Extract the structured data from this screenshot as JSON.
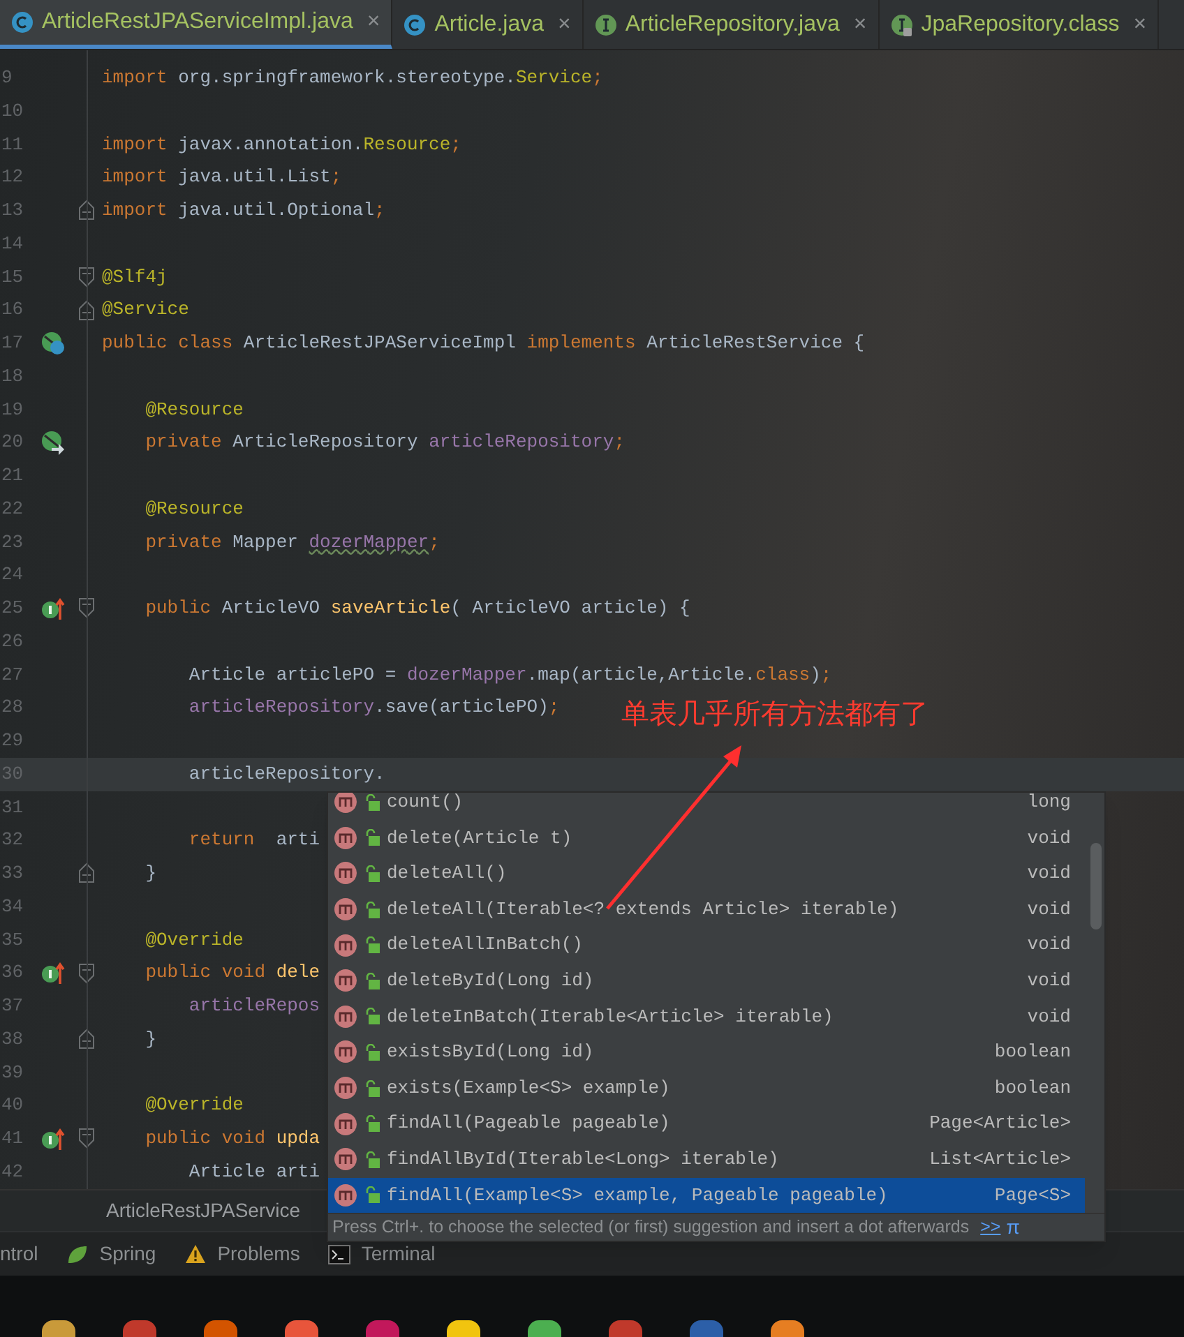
{
  "tabs": [
    {
      "label": "ArticleRestJPAServiceImpl.java",
      "kind": "class",
      "locked": false,
      "selected": true,
      "close": "×"
    },
    {
      "label": "Article.java",
      "kind": "class",
      "locked": false,
      "selected": false,
      "close": "×"
    },
    {
      "label": "ArticleRepository.java",
      "kind": "interface",
      "locked": false,
      "selected": false,
      "close": "×"
    },
    {
      "label": "JpaRepository.class",
      "kind": "interface",
      "locked": true,
      "selected": false,
      "close": "×"
    }
  ],
  "editor": {
    "lines": [
      {
        "number": "9",
        "current": false,
        "tokens": [
          {
            "kind": "kw",
            "text": "import"
          },
          {
            "kind": "text",
            "text": " org.springframework.stereotype."
          },
          {
            "kind": "ann",
            "text": "Service"
          },
          {
            "kind": "semi",
            "text": ";"
          }
        ]
      },
      {
        "number": "10",
        "current": false
      },
      {
        "number": "11",
        "current": false,
        "tokens": [
          {
            "kind": "kw",
            "text": "import"
          },
          {
            "kind": "text",
            "text": " javax.annotation."
          },
          {
            "kind": "ann",
            "text": "Resource"
          },
          {
            "kind": "semi",
            "text": ";"
          }
        ]
      },
      {
        "number": "12",
        "current": false,
        "tokens": [
          {
            "kind": "kw",
            "text": "import"
          },
          {
            "kind": "text",
            "text": " java.util.List"
          },
          {
            "kind": "semi",
            "text": ";"
          }
        ]
      },
      {
        "number": "13",
        "current": false,
        "fold": {
          "kind": "end"
        },
        "tokens": [
          {
            "kind": "kw",
            "text": "import"
          },
          {
            "kind": "text",
            "text": " java.util.Optional"
          },
          {
            "kind": "semi",
            "text": ";"
          }
        ]
      },
      {
        "number": "14",
        "current": false
      },
      {
        "number": "15",
        "current": false,
        "fold": {
          "kind": "start"
        },
        "tokens": [
          {
            "kind": "ann",
            "text": "@Slf4j"
          }
        ]
      },
      {
        "number": "16",
        "current": false,
        "fold": {
          "kind": "end"
        },
        "tokens": [
          {
            "kind": "ann",
            "text": "@Service"
          }
        ]
      },
      {
        "number": "17",
        "current": false,
        "gutter": {
          "kind": "class"
        },
        "tokens": [
          {
            "kind": "kw",
            "text": "public class"
          },
          {
            "kind": "text",
            "text": " ArticleRestJPAServiceImpl "
          },
          {
            "kind": "kw",
            "text": "implements"
          },
          {
            "kind": "text",
            "text": " ArticleRestService {"
          }
        ]
      },
      {
        "number": "18",
        "current": false
      },
      {
        "number": "19",
        "current": false,
        "tokens": [
          {
            "kind": "ann",
            "text": "    @Resource"
          }
        ]
      },
      {
        "number": "20",
        "current": false,
        "gutter": {
          "kind": "field"
        },
        "tokens": [
          {
            "kind": "kw",
            "text": "    private"
          },
          {
            "kind": "text",
            "text": " ArticleRepository "
          },
          {
            "kind": "field",
            "text": "articleRepository"
          },
          {
            "kind": "semi",
            "text": ";"
          }
        ]
      },
      {
        "number": "21",
        "current": false
      },
      {
        "number": "22",
        "current": false,
        "tokens": [
          {
            "kind": "ann",
            "text": "    @Resource"
          }
        ]
      },
      {
        "number": "23",
        "current": false,
        "tokens": [
          {
            "kind": "kw",
            "text": "    private"
          },
          {
            "kind": "text",
            "text": " Mapper "
          },
          {
            "kind": "warn",
            "text": "dozerMapper"
          },
          {
            "kind": "semi",
            "text": ";"
          }
        ]
      },
      {
        "number": "24",
        "current": false
      },
      {
        "number": "25",
        "current": false,
        "gutter": {
          "kind": "implements"
        },
        "fold": {
          "kind": "start"
        },
        "tokens": [
          {
            "kind": "kw",
            "text": "    public"
          },
          {
            "kind": "text",
            "text": " ArticleVO "
          },
          {
            "kind": "fn",
            "text": "saveArticle"
          },
          {
            "kind": "text",
            "text": "( ArticleVO article) {"
          }
        ]
      },
      {
        "number": "26",
        "current": false
      },
      {
        "number": "27",
        "current": false,
        "tokens": [
          {
            "kind": "text",
            "text": "        Article articlePO = "
          },
          {
            "kind": "field",
            "text": "dozerMapper"
          },
          {
            "kind": "text",
            "text": ".map(article,Article."
          },
          {
            "kind": "kw",
            "text": "class"
          },
          {
            "kind": "text",
            "text": ")"
          },
          {
            "kind": "semi",
            "text": ";"
          }
        ]
      },
      {
        "number": "28",
        "current": false,
        "tokens": [
          {
            "kind": "field",
            "text": "        articleRepository"
          },
          {
            "kind": "text",
            "text": ".save(articlePO)"
          },
          {
            "kind": "semi",
            "text": ";"
          }
        ]
      },
      {
        "number": "29",
        "current": false
      },
      {
        "number": "30",
        "current": true,
        "tokens": [
          {
            "kind": "text",
            "text": "        articleRepository."
          }
        ]
      },
      {
        "number": "31",
        "current": false
      },
      {
        "number": "32",
        "current": false,
        "tokens": [
          {
            "kind": "kw",
            "text": "        return"
          },
          {
            "kind": "text",
            "text": "  arti"
          }
        ]
      },
      {
        "number": "33",
        "current": false,
        "fold": {
          "kind": "end"
        },
        "tokens": [
          {
            "kind": "text",
            "text": "    }"
          }
        ]
      },
      {
        "number": "34",
        "current": false
      },
      {
        "number": "35",
        "current": false,
        "tokens": [
          {
            "kind": "ann",
            "text": "    @Override"
          }
        ]
      },
      {
        "number": "36",
        "current": false,
        "gutter": {
          "kind": "implements"
        },
        "fold": {
          "kind": "start"
        },
        "tokens": [
          {
            "kind": "kw",
            "text": "    public void "
          },
          {
            "kind": "fn",
            "text": "dele"
          }
        ]
      },
      {
        "number": "37",
        "current": false,
        "tokens": [
          {
            "kind": "field",
            "text": "        articleRepos"
          }
        ]
      },
      {
        "number": "38",
        "current": false,
        "fold": {
          "kind": "end"
        },
        "tokens": [
          {
            "kind": "text",
            "text": "    }"
          }
        ]
      },
      {
        "number": "39",
        "current": false
      },
      {
        "number": "40",
        "current": false,
        "tokens": [
          {
            "kind": "ann",
            "text": "    @Override"
          }
        ]
      },
      {
        "number": "41",
        "current": false,
        "gutter": {
          "kind": "implements"
        },
        "fold": {
          "kind": "start"
        },
        "tokens": [
          {
            "kind": "kw",
            "text": "    public void "
          },
          {
            "kind": "fn",
            "text": "upda"
          }
        ]
      },
      {
        "number": "42",
        "current": false,
        "tokens": [
          {
            "kind": "text",
            "text": "        Article arti"
          }
        ]
      }
    ]
  },
  "completion": {
    "items": [
      {
        "name": "count()",
        "type": "long",
        "selected": false
      },
      {
        "name": "delete(Article t)",
        "type": "void",
        "selected": false
      },
      {
        "name": "deleteAll()",
        "type": "void",
        "selected": false
      },
      {
        "name": "deleteAll(Iterable<? extends Article> iterable)",
        "type": "void",
        "selected": false
      },
      {
        "name": "deleteAllInBatch()",
        "type": "void",
        "selected": false
      },
      {
        "name": "deleteById(Long id)",
        "type": "void",
        "selected": false
      },
      {
        "name": "deleteInBatch(Iterable<Article> iterable)",
        "type": "void",
        "selected": false
      },
      {
        "name": "existsById(Long id)",
        "type": "boolean",
        "selected": false
      },
      {
        "name": "exists(Example<S> example)",
        "type": "boolean",
        "selected": false
      },
      {
        "name": "findAll(Pageable pageable)",
        "type": "Page<Article>",
        "selected": false
      },
      {
        "name": "findAllById(Iterable<Long> iterable)",
        "type": "List<Article>",
        "selected": false
      },
      {
        "name": "findAll(Example<S> example, Pageable pageable)",
        "type": "Page<S>",
        "selected": true
      }
    ],
    "hint": "Press Ctrl+. to choose the selected (or first) suggestion and insert a dot afterwards",
    "hint_link": ">>",
    "hint_symbol": "π"
  },
  "annotation": "单表几乎所有方法都有了",
  "breadcrumb": "ArticleRestJPAService",
  "tool_windows": [
    {
      "label": "ntrol",
      "kind": "none"
    },
    {
      "label": "Spring",
      "kind": "spring"
    },
    {
      "label": "Problems",
      "kind": "problems"
    },
    {
      "label": "Terminal",
      "kind": "terminal"
    }
  ]
}
